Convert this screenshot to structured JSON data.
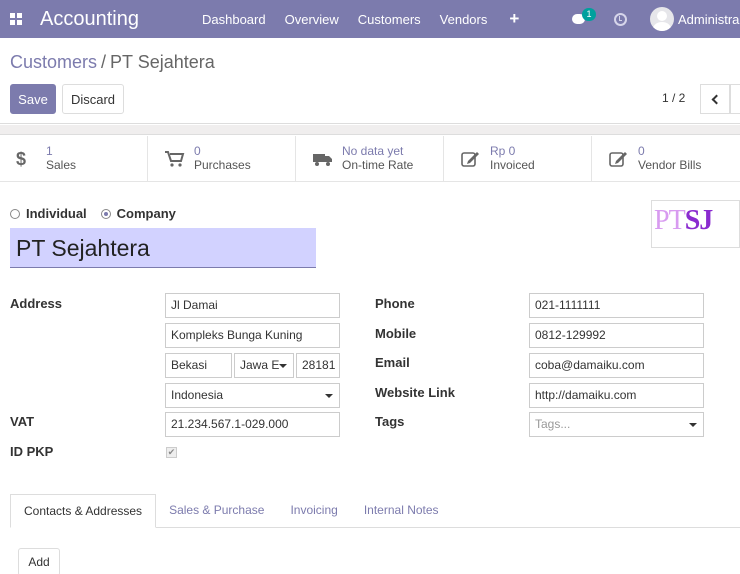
{
  "navbar": {
    "app_title": "Accounting",
    "menu": [
      "Dashboard",
      "Overview",
      "Customers",
      "Vendors"
    ],
    "plus": "+",
    "chat_badge": "1",
    "user_name": "Administra"
  },
  "control_panel": {
    "breadcrumb_parent": "Customers",
    "breadcrumb_sep": "/",
    "breadcrumb_current": "PT Sejahtera",
    "save_label": "Save",
    "discard_label": "Discard",
    "pager": "1 / 2"
  },
  "stats": [
    {
      "icon": "dollar-icon",
      "value": "1",
      "label": "Sales"
    },
    {
      "icon": "cart-icon",
      "value": "0",
      "label": "Purchases"
    },
    {
      "icon": "truck-icon",
      "value": "No data yet",
      "label": "On-time Rate"
    },
    {
      "icon": "edit-icon",
      "value": "Rp 0",
      "label": "Invoiced"
    },
    {
      "icon": "edit-icon",
      "value": "0",
      "label": "Vendor Bills"
    }
  ],
  "form": {
    "type_individual": "Individual",
    "type_company": "Company",
    "selected_type": "Company",
    "name": "PT Sejahtera",
    "logo_text_light": "PT",
    "logo_text_bold": "SJ",
    "address_label": "Address",
    "street": "Jl Damai",
    "street2": "Kompleks Bunga Kuning",
    "city": "Bekasi",
    "state": "Jawa E",
    "zip": "28181",
    "country": "Indonesia",
    "vat_label": "VAT",
    "vat": "21.234.567.1-029.000",
    "id_pkp_label": "ID PKP",
    "id_pkp_checked": true,
    "phone_label": "Phone",
    "phone": "021-1111111",
    "mobile_label": "Mobile",
    "mobile": "0812-129992",
    "email_label": "Email",
    "email": "coba@damaiku.com",
    "website_label": "Website Link",
    "website": "http://damaiku.com",
    "tags_label": "Tags",
    "tags_placeholder": "Tags..."
  },
  "tabs": [
    "Contacts & Addresses",
    "Sales & Purchase",
    "Invoicing",
    "Internal Notes"
  ],
  "active_tab": "Contacts & Addresses",
  "add_label": "Add",
  "colors": {
    "brand": "#7c7bad",
    "name_field_bg": "#d2d2ff",
    "chat_badge": "#00a09d"
  }
}
